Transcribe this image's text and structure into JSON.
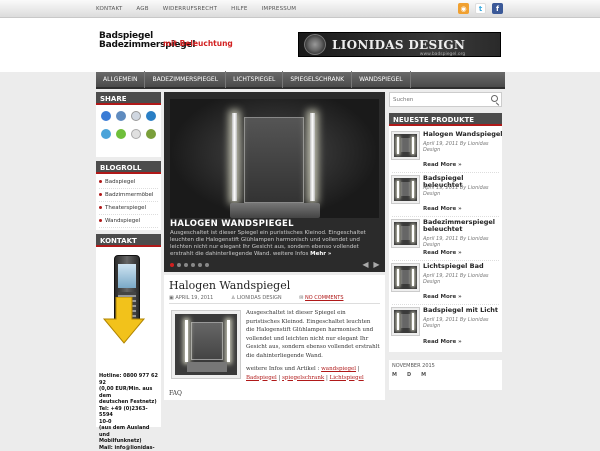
{
  "topnav": [
    "KONTAKT",
    "AGB",
    "WIDERRUFSRECHT",
    "HILFE",
    "IMPRESSUM"
  ],
  "social": [
    "rss-icon",
    "twitter-icon",
    "facebook-icon"
  ],
  "logo": {
    "line1": "Badspiegel",
    "line2": "Badezimmerspiegel",
    "accent": "mit Beleuchtung"
  },
  "banner": {
    "brand": "LIONIDAS DESIGN",
    "url": "www.badspiegel.org"
  },
  "mainnav": [
    "ALLGEMEIN",
    "BADEZIMMERSPIEGEL",
    "LICHTSPIEGEL",
    "SPIEGELSCHRANK",
    "WANDSPIEGEL"
  ],
  "sidebar_left": {
    "share_title": "SHARE",
    "blogroll_title": "BLOGROLL",
    "blogroll": [
      "Badspiegel",
      "Badzimmermöbel",
      "Theaterspiegel",
      "Wandspiegel"
    ],
    "kontakt_title": "KONTAKT",
    "kontakt_text": [
      "Hotline: 0800 977 62 92",
      "(0,00 EUR/Min. aus dem",
      "deutschen Festnetz)",
      "Tel: +49 (0)2363-5594",
      "10-0",
      "(aus dem Ausland und",
      "Mobilfunknetz)",
      "Mail: info@lionidas-"
    ]
  },
  "slider": {
    "title": "HALOGEN WANDSPIEGEL",
    "text": "Ausgeschaltet ist dieser Spiegel ein puristisches Kleinod. Eingeschaltet leuchten die Halogenstift Glühlampen harmonisch und vollendet und leichten nicht nur elegant Ihr Gesicht aus, sondern ebenso vollendet erstrahlt die dahinterliegende Wand. weitere Infos",
    "more": "Mehr »",
    "slides": 6,
    "active": 0
  },
  "post": {
    "title": "Halogen Wandspiegel",
    "date": "APRIL 19, 2011",
    "author": "LIONIDAS DESIGN",
    "comments": "NO COMMENTS",
    "text": "Ausgeschaltet ist dieser Spiegel ein puristisches Kleinod. Eingeschaltet leuchten die Halogenstift Glühlampen harmonisch und vollendet und leichten nicht nur elegant Ihr Gesicht aus, sondern ebenso vollendet erstrahlt die dahinterliegende Wand.",
    "links_prefix": "weitere Infos und Artikel :",
    "links": [
      "wandspiegel",
      "Badspiegel",
      "spiegelschrank",
      "Lichtspiegel"
    ],
    "faq": "FAQ"
  },
  "search": {
    "placeholder": "Suchen"
  },
  "neueste": {
    "title": "NEUESTE PRODUKTE",
    "items": [
      {
        "name": "Halogen Wandspiegel",
        "date": "April 19, 2011 By Lionidas Design",
        "more": "Read More »"
      },
      {
        "name": "Badspiegel beleuchtet",
        "date": "April 19, 2011 By Lionidas Design",
        "more": "Read More »"
      },
      {
        "name": "Badezimmerspiegel beleuchtet",
        "date": "April 19, 2011 By Lionidas Design",
        "more": "Read More »"
      },
      {
        "name": "Lichtspiegel Bad",
        "date": "April 19, 2011 By Lionidas Design",
        "more": "Read More »"
      },
      {
        "name": "Badspiegel mit Licht",
        "date": "April 19, 2011 By Lionidas Design",
        "more": "Read More »"
      }
    ]
  },
  "calendar": {
    "month": "NOVEMBER 2015",
    "days": [
      "M",
      "D",
      "M"
    ]
  },
  "colors": {
    "accent": "#b01919",
    "nav": "#4a4a4a"
  }
}
